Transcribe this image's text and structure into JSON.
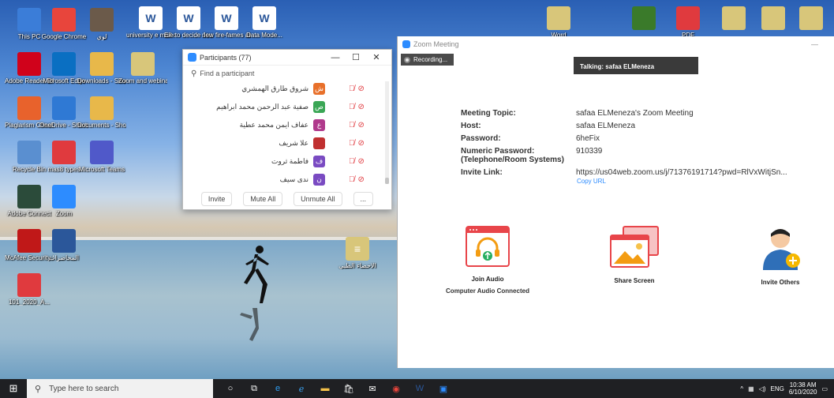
{
  "desktop": {
    "icons_left": [
      {
        "label": "This PC",
        "icon": "pc-icon",
        "color": "#3b7dd8"
      },
      {
        "label": "Google Chrome",
        "icon": "chrome-icon",
        "color": "#e8453c"
      },
      {
        "label": "لوي",
        "icon": "image-file-icon",
        "color": "#6b5a4a"
      },
      {
        "label": "Adobe Reader DC",
        "icon": "acrobat-icon",
        "color": "#d0021b"
      },
      {
        "label": "Microsoft Edge",
        "icon": "edge-icon",
        "color": "#0a6fc2"
      },
      {
        "label": "Downloads - Shortcut",
        "icon": "folder-icon",
        "color": "#e8b84a"
      },
      {
        "label": "Zoom and webinars",
        "icon": "doc-icon",
        "color": "#d8c67a"
      },
      {
        "label": "Plagiarism Checker X",
        "icon": "x-icon",
        "color": "#e8622c"
      },
      {
        "label": "OneDrive - Shortcut",
        "icon": "onedrive-icon",
        "color": "#2f79d4"
      },
      {
        "label": "Documents - Shortcut",
        "icon": "folder-icon",
        "color": "#e8b84a"
      },
      {
        "label": "Recycle Bin",
        "icon": "recycle-bin-icon",
        "color": "#5a8fd0"
      },
      {
        "label": "mas8 types",
        "icon": "pdf-icon",
        "color": "#e03a3e"
      },
      {
        "label": "Microsoft Teams",
        "icon": "teams-icon",
        "color": "#5059c9"
      },
      {
        "label": "Adobe Connect",
        "icon": "connect-icon",
        "color": "#2b4b3a"
      },
      {
        "label": "Zoom",
        "icon": "zoom-icon",
        "color": "#2d8cff"
      },
      {
        "label": "McAfee Security Sc...",
        "icon": "mcafee-icon",
        "color": "#c01818"
      },
      {
        "label": "المحاضرات",
        "icon": "word-icon",
        "color": "#2b579a"
      },
      {
        "label": "101_2020_A...",
        "icon": "pdf-icon",
        "color": "#e03a3e"
      }
    ],
    "icons_top": [
      {
        "label": "university e mail details",
        "icon": "word-icon"
      },
      {
        "label": "Ele to decide Journal hrs.p...",
        "icon": "word-icon"
      },
      {
        "label": "new fire-fames ab...",
        "icon": "word-icon"
      },
      {
        "label": "Data Mode...",
        "icon": "word-icon"
      }
    ],
    "icons_topright": [
      {
        "label": "Word",
        "icon": "doc-icon"
      },
      {
        "label": "",
        "icon": "tree-icon"
      },
      {
        "label": "PDF",
        "icon": "pdf-icon"
      },
      {
        "label": "",
        "icon": "doc-icon"
      },
      {
        "label": "",
        "icon": "doc-icon"
      },
      {
        "label": "",
        "icon": "doc-icon"
      }
    ],
    "icon_middle": {
      "label": "الاحصاء الطبي",
      "icon": "doc-icon"
    }
  },
  "participants": {
    "title": "Participants (77)",
    "search_placeholder": "Find a participant",
    "rows": [
      {
        "name": "شروق طارق الهمشري",
        "initial": "ش",
        "color": "#e8702a"
      },
      {
        "name": "صفية عبد الرحمن محمد ابراهيم",
        "initial": "ص",
        "color": "#3aa655"
      },
      {
        "name": "عفاف ايمن محمد عطية",
        "initial": "ع",
        "color": "#b03a8c"
      },
      {
        "name": "علا شريف",
        "initial": "",
        "color": "#c03030"
      },
      {
        "name": "فاطمة ثروت",
        "initial": "ف",
        "color": "#7a4bc2"
      },
      {
        "name": "ندى سيف",
        "initial": "ن",
        "color": "#7a4bc2"
      }
    ],
    "buttons": {
      "invite": "Invite",
      "mute_all": "Mute All",
      "unmute_all": "Unmute All",
      "more": "..."
    }
  },
  "meeting": {
    "window_title": "Zoom Meeting",
    "recording": "Recording...",
    "talking": "Talking: safaa ELMeneza",
    "info": [
      {
        "key": "Meeting Topic:",
        "value": "safaa ELMeneza's Zoom Meeting"
      },
      {
        "key": "Host:",
        "value": "safaa ELMeneza"
      },
      {
        "key": "Password:",
        "value": "6heFix"
      },
      {
        "key": "Numeric Password:\n(Telephone/Room Systems)",
        "value": "910339"
      },
      {
        "key": "Invite Link:",
        "value": "https://us04web.zoom.us/j/71376191714?pwd=RlVxWitjSn..."
      }
    ],
    "copy_url": "Copy URL",
    "join_audio": "Join Audio",
    "audio_status": "Computer Audio Connected",
    "share_screen": "Share Screen",
    "invite_others": "Invite Others"
  },
  "taskbar": {
    "search_placeholder": "Type here to search",
    "language": "ENG",
    "time": "10:38 AM",
    "date": "6/10/2020"
  }
}
